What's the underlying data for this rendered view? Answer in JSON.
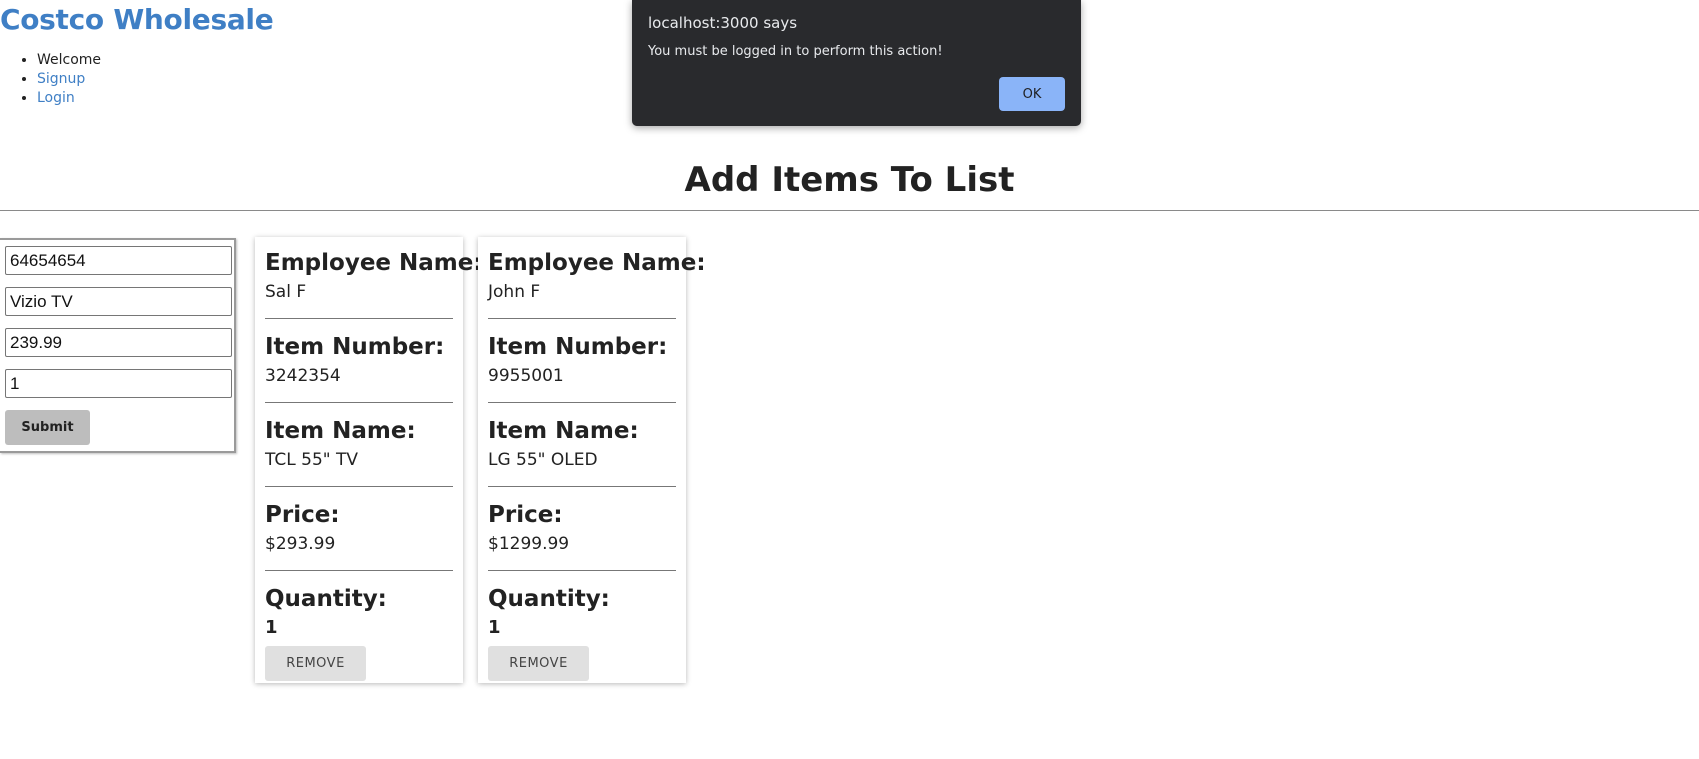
{
  "header": {
    "brand": "Costco Wholesale",
    "nav": [
      {
        "label": "Welcome"
      },
      {
        "label": "Signup"
      },
      {
        "label": "Login"
      }
    ]
  },
  "main": {
    "title": "Add Items To List"
  },
  "form": {
    "fields": [
      {
        "value": "64654654"
      },
      {
        "value": "Vizio TV"
      },
      {
        "value": "239.99"
      },
      {
        "value": "1"
      }
    ],
    "submit_label": "Submit"
  },
  "labels": {
    "employee_name": "Employee Name:",
    "item_number": "Item Number:",
    "item_name": "Item Name:",
    "price": "Price:",
    "quantity": "Quantity:",
    "remove": "REMOVE"
  },
  "items": [
    {
      "employee_name": "Sal F",
      "item_number": "3242354",
      "item_name": "TCL 55\" TV",
      "price": "$293.99",
      "quantity": "1"
    },
    {
      "employee_name": "John F",
      "item_number": "9955001",
      "item_name": "LG 55\" OLED",
      "price": "$1299.99",
      "quantity": "1"
    }
  ],
  "dialog": {
    "title": "localhost:3000 says",
    "message": "You must be logged in to perform this action!",
    "ok_label": "OK"
  },
  "colors": {
    "link": "#3f7fc5",
    "dialog_bg": "#292a2d",
    "dialog_button": "#8ab4f8"
  }
}
